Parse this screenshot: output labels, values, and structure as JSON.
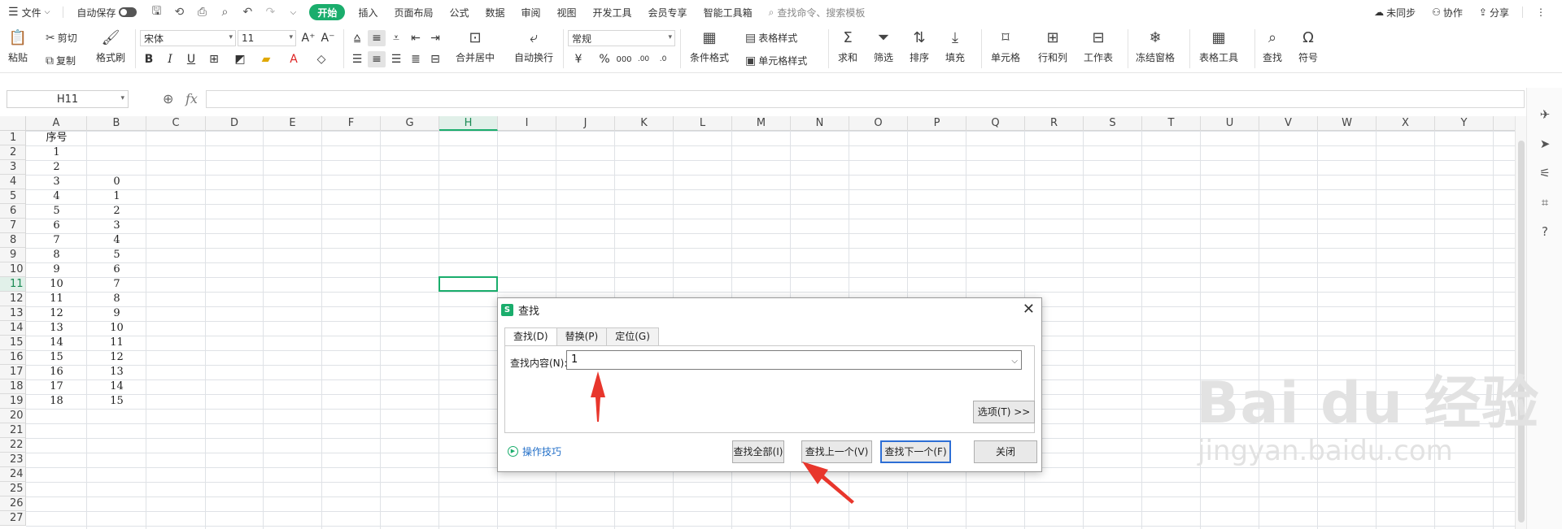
{
  "menubar": {
    "file": "文件",
    "autosave": "自动保存",
    "tabs": [
      "开始",
      "插入",
      "页面布局",
      "公式",
      "数据",
      "审阅",
      "视图",
      "开发工具",
      "会员专享",
      "智能工具箱"
    ],
    "active_tab": "开始",
    "search_placeholder": "查找命令、搜索模板",
    "sync": "未同步",
    "collab": "协作",
    "share": "分享"
  },
  "ribbon": {
    "paste": "粘贴",
    "cut": "剪切",
    "copy": "复制",
    "format_painter": "格式刷",
    "font_name": "宋体",
    "font_size": "11",
    "merge_center": "合并居中",
    "wrap_text": "自动换行",
    "number_format": "常规",
    "conditional_format": "条件格式",
    "table_style": "表格样式",
    "cell_style": "单元格样式",
    "sum": "求和",
    "filter": "筛选",
    "sort": "排序",
    "fill": "填充",
    "cell": "单元格",
    "row_col": "行和列",
    "worksheet": "工作表",
    "freeze": "冻结窗格",
    "table_tools": "表格工具",
    "find": "查找",
    "symbol": "符号"
  },
  "formula_bar": {
    "name_box": "H11",
    "fx": "fx",
    "value": ""
  },
  "sheet": {
    "columns": [
      "A",
      "B",
      "C",
      "D",
      "E",
      "F",
      "G",
      "H",
      "I",
      "J",
      "K",
      "L",
      "M",
      "N",
      "O",
      "P",
      "Q",
      "R",
      "S",
      "T",
      "U",
      "V",
      "W",
      "X",
      "Y"
    ],
    "rows": [
      "1",
      "2",
      "3",
      "4",
      "5",
      "6",
      "7",
      "8",
      "9",
      "10",
      "11",
      "12",
      "13",
      "14",
      "15",
      "16",
      "17",
      "18",
      "19",
      "20",
      "21",
      "22",
      "23",
      "24",
      "25",
      "26",
      "27"
    ],
    "active_column": "H",
    "active_row": "11",
    "colA": [
      "序号",
      "1",
      "2",
      "3",
      "4",
      "5",
      "6",
      "7",
      "8",
      "9",
      "10",
      "11",
      "12",
      "13",
      "14",
      "15",
      "16",
      "17",
      "18"
    ],
    "colB": [
      "",
      "",
      "",
      "0",
      "1",
      "2",
      "3",
      "4",
      "5",
      "6",
      "7",
      "8",
      "9",
      "10",
      "11",
      "12",
      "13",
      "14",
      "15"
    ]
  },
  "dialog": {
    "title": "查找",
    "tabs": [
      "查找(D)",
      "替换(P)",
      "定位(G)"
    ],
    "active_tab": "查找(D)",
    "find_label": "查找内容(N):",
    "find_value": "1",
    "options": "选项(T) >>",
    "tips": "操作技巧",
    "find_all": "查找全部(I)",
    "find_prev": "查找上一个(V)",
    "find_next": "查找下一个(F)",
    "close": "关闭"
  },
  "watermark": {
    "brand": "Bai du 经验",
    "url": "jingyan.baidu.com"
  },
  "colors": {
    "accent": "#1aad6c",
    "arrow": "#e8362c",
    "primary_border": "#2d6ed5"
  }
}
